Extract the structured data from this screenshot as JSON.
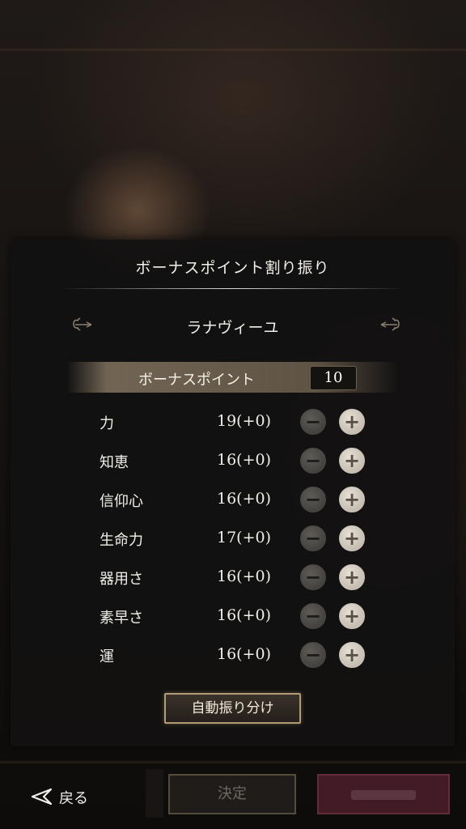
{
  "dialog": {
    "title": "ボーナスポイント割り振り",
    "character_name": "ラナヴィーユ",
    "bonus_points": {
      "label": "ボーナスポイント",
      "value": "10"
    },
    "stats": [
      {
        "name": "力",
        "value": "19(+0)"
      },
      {
        "name": "知恵",
        "value": "16(+0)"
      },
      {
        "name": "信仰心",
        "value": "16(+0)"
      },
      {
        "name": "生命力",
        "value": "17(+0)"
      },
      {
        "name": "器用さ",
        "value": "16(+0)"
      },
      {
        "name": "素早さ",
        "value": "16(+0)"
      },
      {
        "name": "運",
        "value": "16(+0)"
      }
    ],
    "minus_symbol": "−",
    "plus_symbol": "+",
    "auto_assign_label": "自動振り分け"
  },
  "footer": {
    "back_label": "戻る",
    "back_icon": "back-arrow-icon",
    "confirm_label": "決定"
  },
  "colors": {
    "accent_gold": "#b29c78",
    "confirm_disabled": "#c8c3b9",
    "secondary_button": "#6e283c"
  }
}
